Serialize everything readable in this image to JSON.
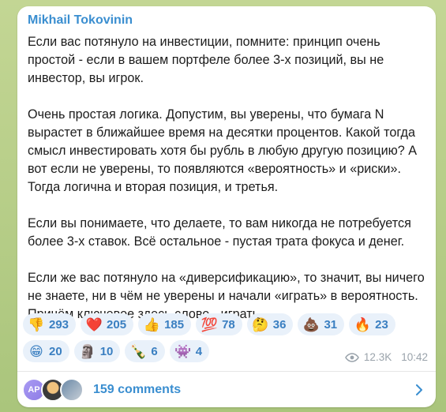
{
  "message": {
    "author": "Mikhail Tokovinin",
    "paragraphs": [
      "Если вас потянуло на инвестиции, помните: принцип очень простой - если в вашем портфеле более 3-х позиций, вы не инвестор, вы игрок.",
      "Очень простая логика. Допустим, вы уверены, что бумага N вырастет в ближайшее время на десятки процентов. Какой тогда смысл инвестировать хотя бы рубль в любую другую позицию? А вот если не уверены, то появляются «вероятность» и «риски». Тогда логична и вторая позиция, и третья.",
      "Если вы понимаете, что делаете, то вам никогда не потребуется более 3-х ставок. Всё остальное - пустая трата фокуса и денег.",
      "Если же вас потянуло на «диверсификацию», то значит, вы ничего не знаете, ни в чём не уверены и начали «играть» в вероятность. Причём ключевое здесь слово - играть."
    ],
    "reactions": [
      {
        "emoji": "👎",
        "icon": "thumbs-down-icon",
        "count": "293"
      },
      {
        "emoji": "❤️",
        "icon": "red-heart-icon",
        "count": "205"
      },
      {
        "emoji": "👍",
        "icon": "thumbs-up-icon",
        "count": "185"
      },
      {
        "emoji": "💯",
        "icon": "hundred-points-icon",
        "count": "78"
      },
      {
        "emoji": "🤔",
        "icon": "thinking-face-icon",
        "count": "36"
      },
      {
        "emoji": "💩",
        "icon": "pile-of-poo-icon",
        "count": "31"
      },
      {
        "emoji": "🔥",
        "icon": "fire-icon",
        "count": "23"
      },
      {
        "emoji": "😁",
        "icon": "beaming-face-icon",
        "count": "20"
      },
      {
        "emoji": "🗿",
        "icon": "moai-icon",
        "count": "10"
      },
      {
        "emoji": "🍾",
        "icon": "champagne-bottle-icon",
        "count": "6"
      },
      {
        "emoji": "👾",
        "icon": "alien-monster-icon",
        "count": "4"
      }
    ],
    "views": "12.3K",
    "time": "10:42"
  },
  "comments": {
    "avatar_initials": "AP",
    "label": "159 comments"
  },
  "colors": {
    "accent": "#3a8ed0",
    "reaction_bg": "#e9f1fa",
    "reaction_text": "#3a7fc1",
    "meta_text": "#9aa3ab"
  }
}
